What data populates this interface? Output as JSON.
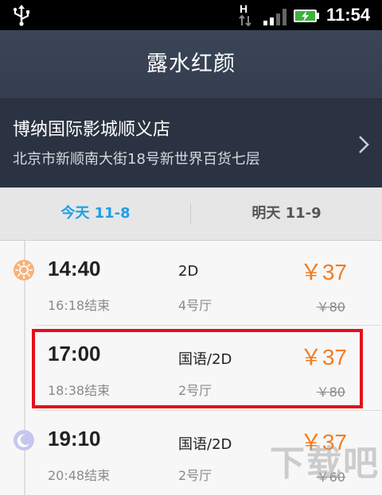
{
  "status_bar": {
    "time": "11:54",
    "network_type": "H",
    "icons": [
      "usb-icon",
      "network-h-icon",
      "signal-icon",
      "battery-charging-icon"
    ]
  },
  "header": {
    "title": "露水红颜"
  },
  "cinema": {
    "name": "博纳国际影城顺义店",
    "address": "北京市新顺南大街18号新世界百货七层"
  },
  "tabs": [
    {
      "label": "今天 11-8",
      "active": true
    },
    {
      "label": "明天 11-9",
      "active": false
    }
  ],
  "showtimes": [
    {
      "time": "14:40",
      "end": "16:18结束",
      "format": "2D",
      "hall": "4号厅",
      "price": "￥37",
      "original_price": "￥80",
      "period_icon": "sun-icon"
    },
    {
      "time": "17:00",
      "end": "18:38结束",
      "format": "国语/2D",
      "hall": "2号厅",
      "price": "￥37",
      "original_price": "￥80",
      "highlighted": true
    },
    {
      "time": "19:10",
      "end": "20:48结束",
      "format": "国语/2D",
      "hall": "2号厅",
      "price": "￥37",
      "original_price": "￥60",
      "period_icon": "moon-icon"
    }
  ],
  "colors": {
    "accent_blue": "#1e9fe6",
    "price_orange": "#f57c1f",
    "highlight_red": "#e4101a",
    "header_bg": "#343e4f"
  }
}
